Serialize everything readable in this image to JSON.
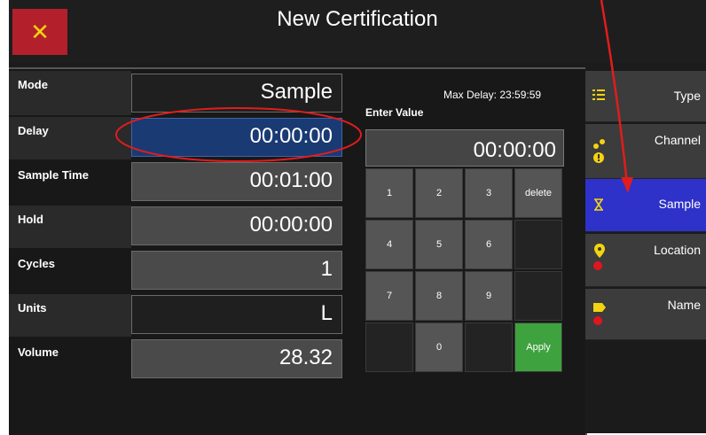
{
  "header": {
    "title": "New Certification",
    "close_glyph": "✕"
  },
  "form": {
    "rows": [
      {
        "label": "Mode",
        "value": "Sample"
      },
      {
        "label": "Delay",
        "value": "00:00:00"
      },
      {
        "label": "Sample Time",
        "value": "00:01:00"
      },
      {
        "label": "Hold",
        "value": "00:00:00"
      },
      {
        "label": "Cycles",
        "value": "1"
      },
      {
        "label": "Units",
        "value": "L"
      },
      {
        "label": "Volume",
        "value": "28.32"
      }
    ]
  },
  "keypad": {
    "max_delay": "Max Delay: 23:59:59",
    "enter_label": "Enter Value",
    "display": "00:00:00",
    "keys": {
      "k1": "1",
      "k2": "2",
      "k3": "3",
      "delete": "delete",
      "k4": "4",
      "k5": "5",
      "k6": "6",
      "k7": "7",
      "k8": "8",
      "k9": "9",
      "k0": "0",
      "apply": "Apply"
    }
  },
  "sidebar": {
    "tabs": [
      {
        "label": "Type",
        "icon": "list-icon"
      },
      {
        "label": "Channel",
        "icon": "channel-icon"
      },
      {
        "label": "Sample",
        "icon": "hourglass-icon",
        "active": true
      },
      {
        "label": "Location",
        "icon": "location-pin-icon"
      },
      {
        "label": "Name",
        "icon": "tag-icon"
      }
    ]
  },
  "colors": {
    "close_bg": "#b3202c",
    "accent_yellow": "#f5d310",
    "selected_field": "#1a3a73",
    "active_tab": "#2e32c8",
    "apply_green": "#3ea23e",
    "warning_red": "#e0151f",
    "annotation_red": "#e11c1c"
  }
}
